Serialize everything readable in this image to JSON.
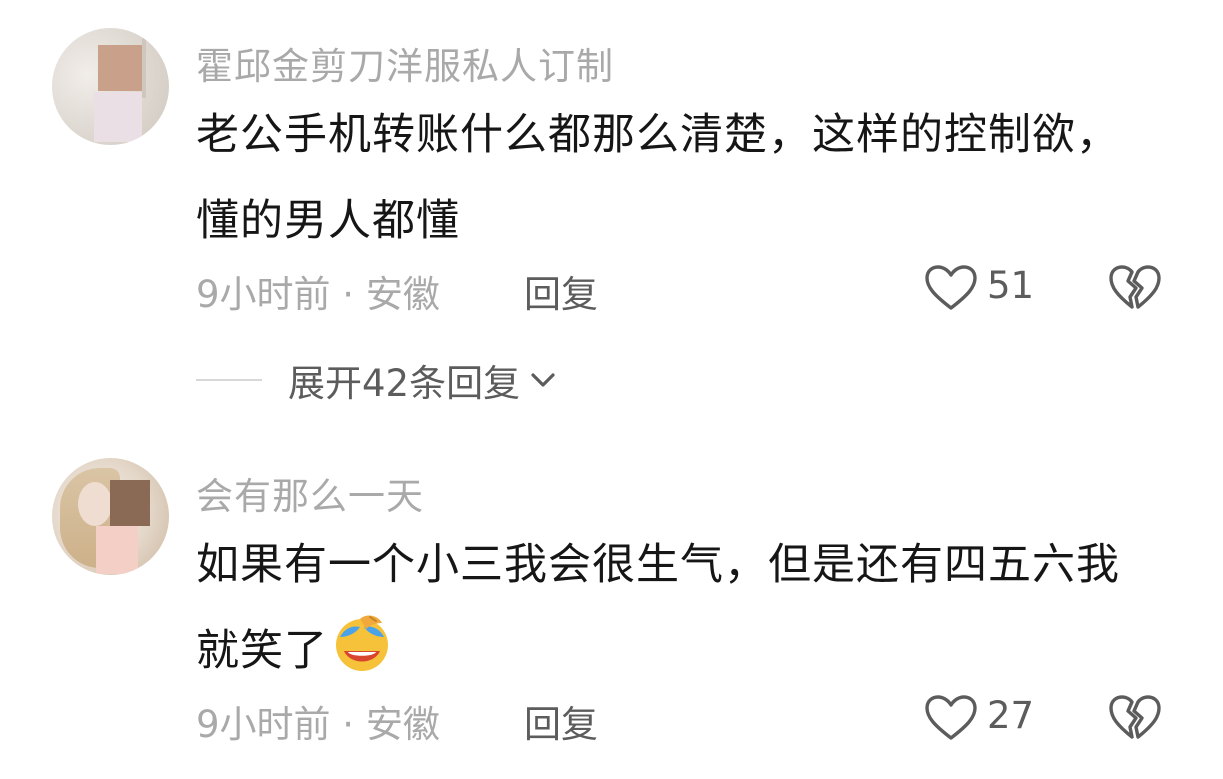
{
  "comments": [
    {
      "author": "霍邱金剪刀洋服私人订制",
      "text": "老公手机转账什么都那么清楚，这样的控制欲，懂的男人都懂",
      "time_location": "9小时前 · 安徽",
      "reply_label": "回复",
      "likes": "51",
      "like_icon": "heart-outline-icon",
      "dislike_icon": "broken-heart-icon",
      "expand_replies": "展开42条回复"
    },
    {
      "author": "会有那么一天",
      "text": "如果有一个小三我会很生气，但是还有四五六我就笑了",
      "emoji": "laughing-crying-emoji",
      "time_location": "9小时前 · 安徽",
      "reply_label": "回复",
      "likes": "27",
      "like_icon": "heart-outline-icon",
      "dislike_icon": "broken-heart-icon"
    }
  ],
  "colors": {
    "text_primary": "#161616",
    "text_secondary": "#a9a9a9",
    "text_action": "#5c5c5c",
    "emoji_face": "#f6c23a",
    "emoji_tear": "#4aa3e8"
  }
}
